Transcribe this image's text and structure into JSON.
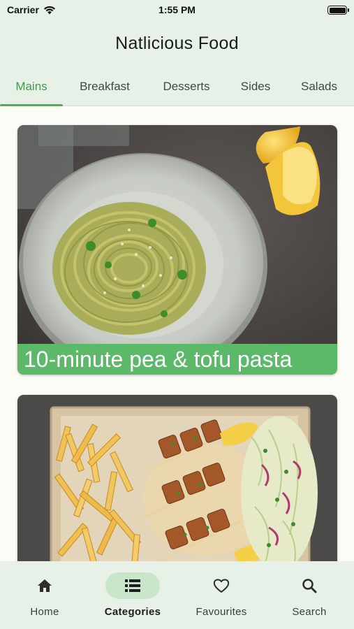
{
  "status_bar": {
    "carrier": "Carrier",
    "time": "1:55 PM"
  },
  "app_bar": {
    "title": "Natlicious Food"
  },
  "tabs": [
    {
      "label": "Mains"
    },
    {
      "label": "Breakfast"
    },
    {
      "label": "Desserts"
    },
    {
      "label": "Sides"
    },
    {
      "label": "Salads"
    }
  ],
  "active_tab": "Mains",
  "recipes": [
    {
      "title": "10-minute pea & tofu pasta"
    },
    {
      "title": ""
    }
  ],
  "bottom_nav": {
    "items": [
      {
        "label": "Home",
        "icon": "home-icon"
      },
      {
        "label": "Categories",
        "icon": "list-icon"
      },
      {
        "label": "Favourites",
        "icon": "heart-icon"
      },
      {
        "label": "Search",
        "icon": "search-icon"
      }
    ],
    "active": "Categories"
  },
  "colors": {
    "accent": "#4caf50",
    "caption_bg": "#5cb96a",
    "bar_bg": "#e8f1e7",
    "active_pill": "#c8e6c9"
  }
}
